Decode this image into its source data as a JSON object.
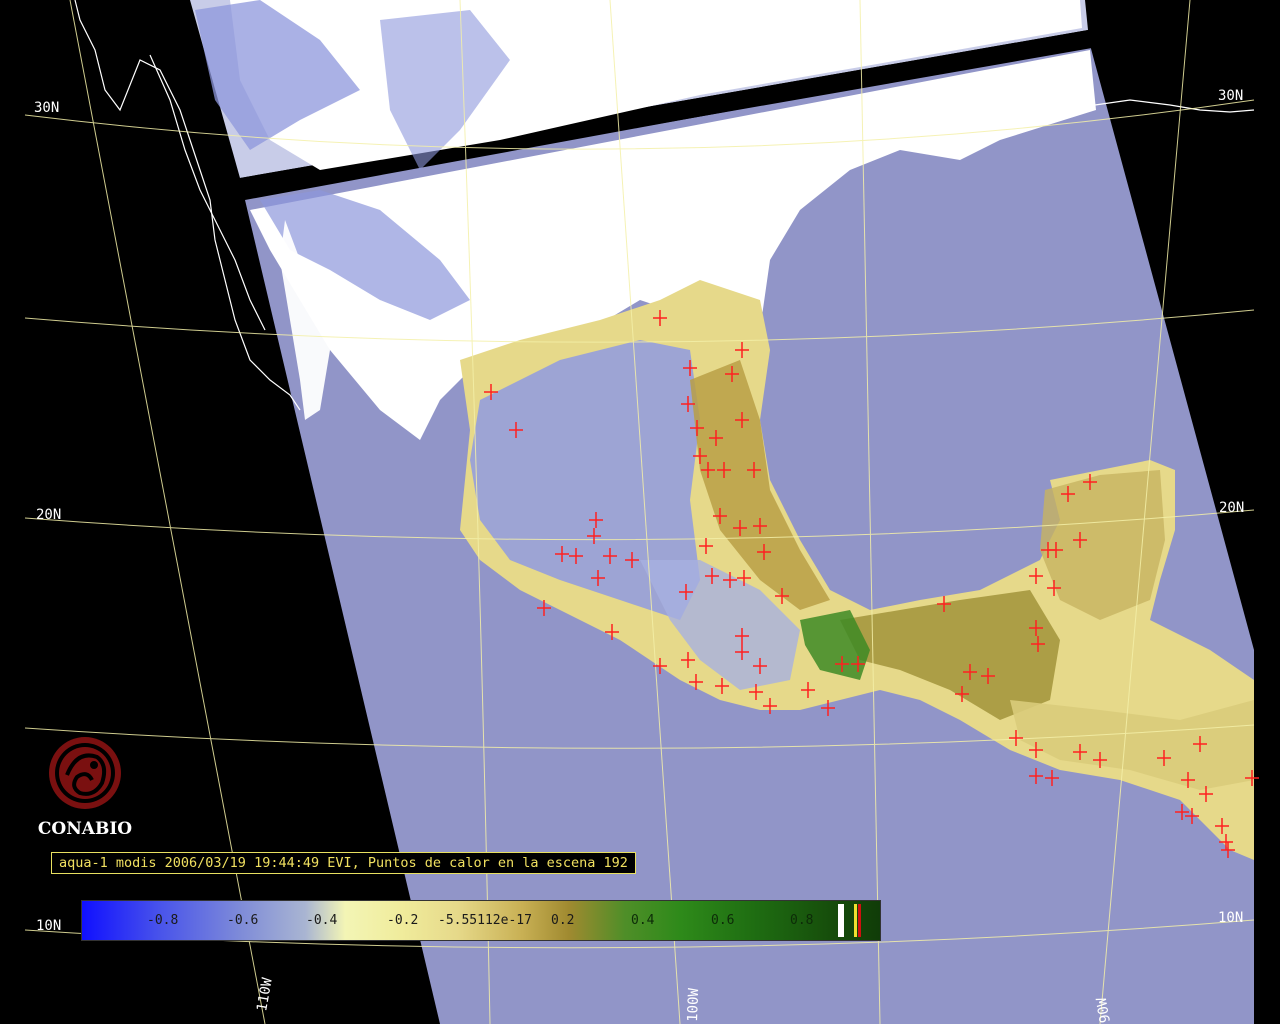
{
  "latitude_labels": {
    "n30_left": "30N",
    "n30_right": "30N",
    "n20_left": "20N",
    "n20_right": "20N",
    "n10_left": "10N",
    "n10_right": "10N"
  },
  "longitude_labels": {
    "w110": "110W",
    "w100": "100W",
    "w90": "90W"
  },
  "logo": {
    "name": "CONABIO"
  },
  "caption": "aqua-1 modis 2006/03/19 19:44:49 EVI, Puntos de calor en la escena 192",
  "colorbar": {
    "ticks": [
      "-0.8",
      "-0.6",
      "-0.4",
      "-0.2",
      "-5.55112e-17",
      "0.2",
      "0.4",
      "0.6",
      "0.8"
    ],
    "special_colors": [
      "#ffffff",
      "#f0e030",
      "#d01010"
    ]
  },
  "colors": {
    "ocean": "#9195c8",
    "cloud": "#ffffff",
    "hotspot": "#ff2020",
    "grid": "#f4f0a8",
    "coastline": "#ffffff"
  }
}
